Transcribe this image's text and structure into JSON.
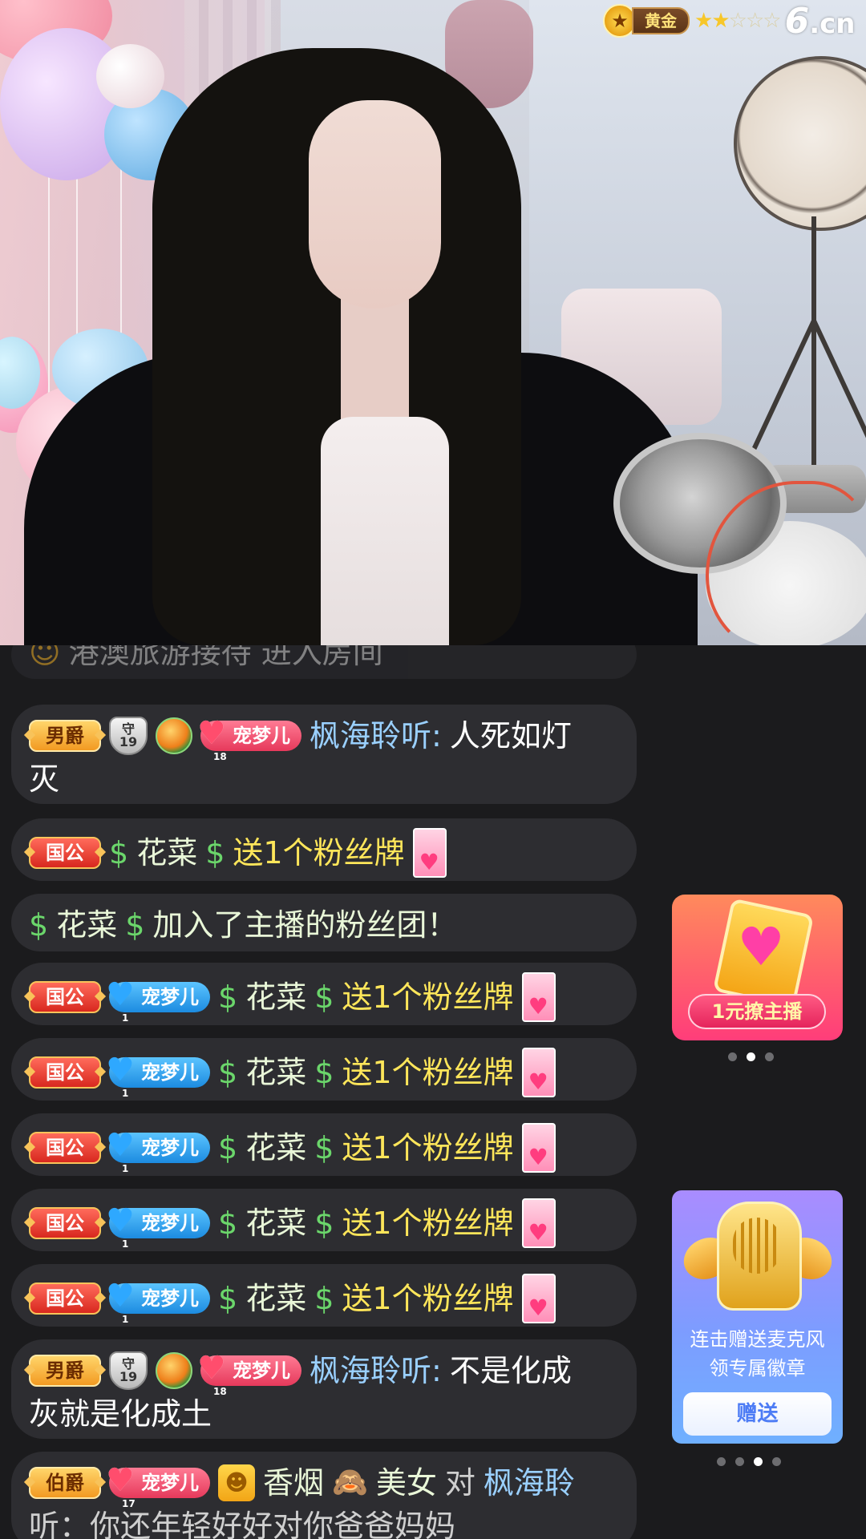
{
  "top_badge": {
    "rank_label": "黄金",
    "stars_filled": 2,
    "stars_total": 5,
    "star_full_glyph": "★",
    "star_empty_glyph": "☆",
    "site_logo_big": "6",
    "site_logo_small": ".cn"
  },
  "chat": {
    "faded_top": "港澳旅游接待 进入房间",
    "msg1": {
      "noble": "男爵",
      "guard_glyph": "守",
      "guard_level": "19",
      "fan_badge": "宠梦儿",
      "fan_level": "18",
      "user": "枫海聆听:",
      "text_line1": "人死如灯",
      "text_line2": "灭"
    },
    "msg2": {
      "noble": "国公",
      "dollar": "$",
      "user": "花菜",
      "action": "送1个粉丝牌"
    },
    "msg3": {
      "dollar": "$",
      "user": "花菜",
      "text": "加入了主播的粉丝团！"
    },
    "gift_rows": [
      {
        "noble": "国公",
        "fan_badge": "宠梦儿",
        "fan_level": "1",
        "dollar": "$",
        "user": "花菜",
        "action": "送1个粉丝牌"
      },
      {
        "noble": "国公",
        "fan_badge": "宠梦儿",
        "fan_level": "1",
        "dollar": "$",
        "user": "花菜",
        "action": "送1个粉丝牌"
      },
      {
        "noble": "国公",
        "fan_badge": "宠梦儿",
        "fan_level": "1",
        "dollar": "$",
        "user": "花菜",
        "action": "送1个粉丝牌"
      },
      {
        "noble": "国公",
        "fan_badge": "宠梦儿",
        "fan_level": "1",
        "dollar": "$",
        "user": "花菜",
        "action": "送1个粉丝牌"
      },
      {
        "noble": "国公",
        "fan_badge": "宠梦儿",
        "fan_level": "1",
        "dollar": "$",
        "user": "花菜",
        "action": "送1个粉丝牌"
      }
    ],
    "msg9": {
      "noble": "男爵",
      "guard_glyph": "守",
      "guard_level": "19",
      "fan_badge": "宠梦儿",
      "fan_level": "18",
      "user": "枫海聆听:",
      "text_line1": "不是化成",
      "text_line2": "灰就是化成土"
    },
    "msg10": {
      "noble": "伯爵",
      "fan_badge": "宠梦儿",
      "fan_level": "17",
      "user": "香烟",
      "monkey": "🙈",
      "user2": "美女",
      "to": "对",
      "target": "枫海聆",
      "text_line2": "听：你还年轻好好对你爸爸妈妈"
    }
  },
  "promo1": {
    "button": "1元撩主播",
    "dots_total": 3,
    "dots_active": 2
  },
  "promo2": {
    "text_line1": "连击赠送麦克风",
    "text_line2": "领专属徽章",
    "button": "赠送",
    "dots_total": 4,
    "dots_active": 3
  },
  "colors": {
    "chat_bubble": "#2d2d31",
    "username_blue": "#9ad0ff",
    "gift_yellow": "#ffe65a",
    "dollar_green": "#6bd66b"
  }
}
